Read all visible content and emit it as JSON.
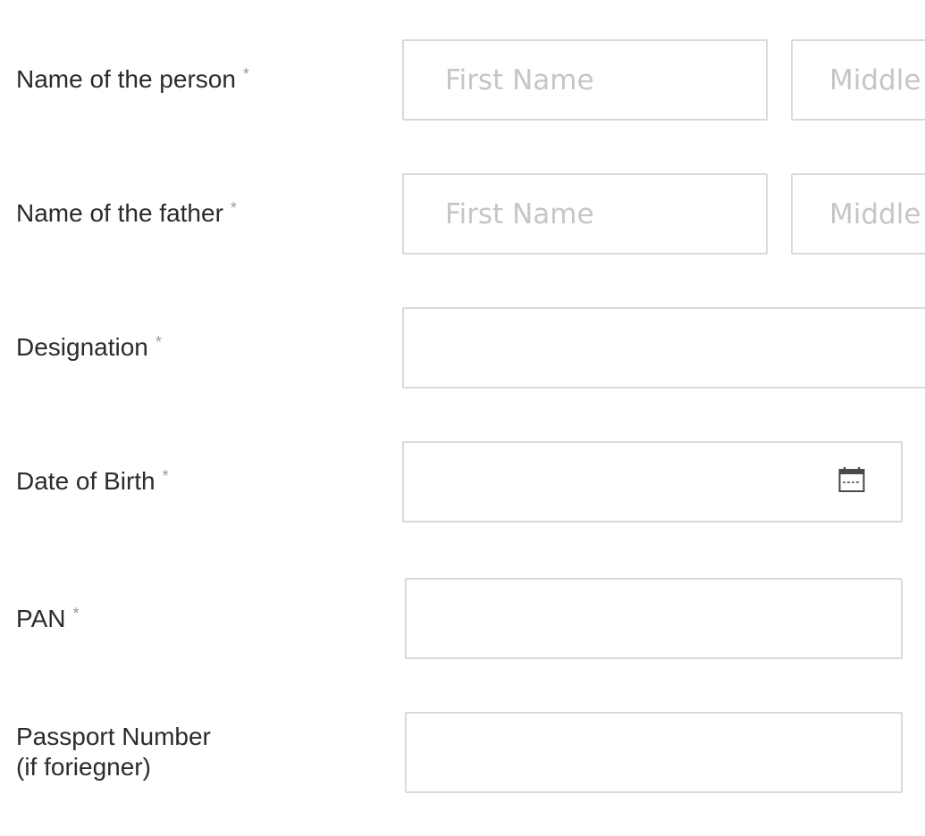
{
  "form": {
    "rows": [
      {
        "label": "Name of the person",
        "required_mark": "*",
        "first_name_placeholder": "First Name",
        "middle_name_placeholder": "Middle"
      },
      {
        "label": "Name of the father",
        "required_mark": "*",
        "first_name_placeholder": "First Name",
        "middle_name_placeholder": "Middle"
      },
      {
        "label": "Designation",
        "required_mark": "*",
        "value": ""
      },
      {
        "label": "Date of Birth",
        "required_mark": "*",
        "value": "",
        "icon": "calendar-icon"
      },
      {
        "label": "PAN",
        "required_mark": "*",
        "value": ""
      },
      {
        "label_line1": "Passport Number",
        "label_line2": "(if foriegner)",
        "value": ""
      }
    ]
  },
  "colors": {
    "label_text": "#2b2b2b",
    "placeholder": "#c6c6c6",
    "border": "#d9d9d9",
    "required_mark": "#9a9a9a"
  }
}
